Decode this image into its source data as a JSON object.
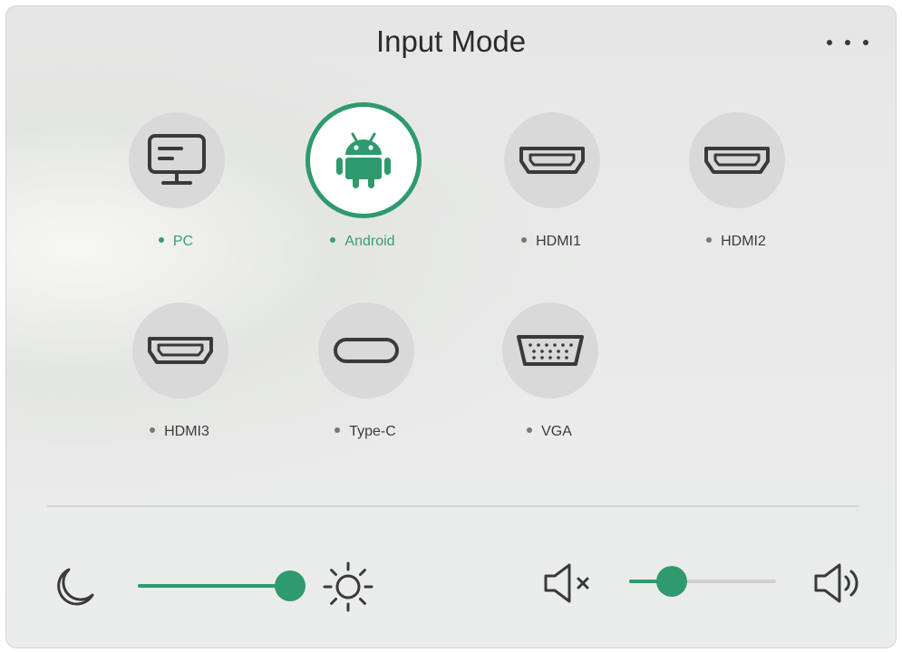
{
  "header": {
    "title": "Input Mode",
    "more_icon": "more-horizontal-icon"
  },
  "sources": [
    {
      "label": "PC",
      "icon": "monitor-icon",
      "selected": false
    },
    {
      "label": "Android",
      "icon": "android-icon",
      "selected": true
    },
    {
      "label": "HDMI1",
      "icon": "hdmi-port-icon",
      "selected": false
    },
    {
      "label": "HDMI2",
      "icon": "hdmi-port-icon",
      "selected": false
    },
    {
      "label": "HDMI3",
      "icon": "hdmi-port-icon",
      "selected": false
    },
    {
      "label": "Type-C",
      "icon": "usb-c-port-icon",
      "selected": false
    },
    {
      "label": "VGA",
      "icon": "vga-port-icon",
      "selected": false
    }
  ],
  "controls": {
    "brightness": {
      "level": 1.0,
      "min_icon": "moon-icon",
      "max_icon": "sun-icon"
    },
    "volume": {
      "level": 0.29,
      "min_icon": "speaker-mute-icon",
      "max_icon": "speaker-loud-icon"
    }
  },
  "colors": {
    "accent": "#2f9a6d",
    "inactive_dot": "#777777",
    "icon_stroke": "#3a3a3a"
  }
}
